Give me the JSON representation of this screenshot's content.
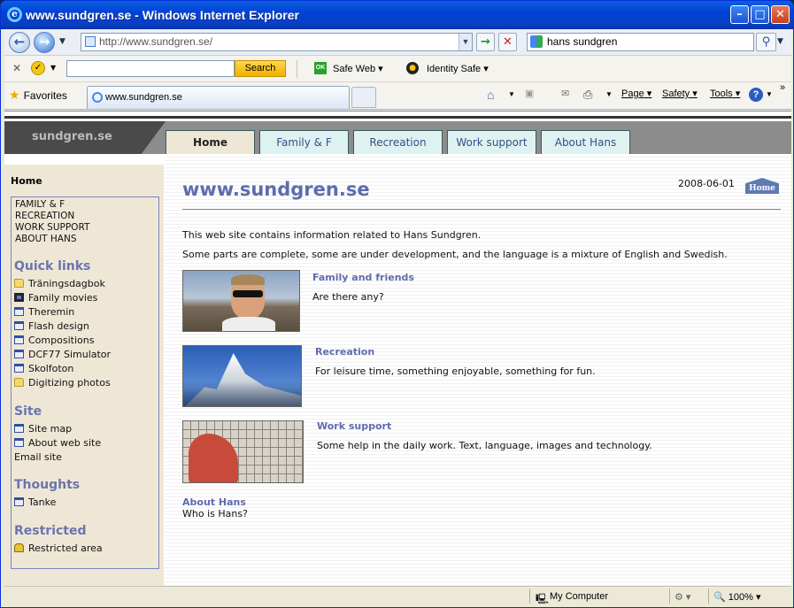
{
  "window": {
    "title": "www.sundgren.se - Windows Internet Explorer"
  },
  "address_bar": {
    "url": "http://www.sundgren.se/",
    "search_value": "hans sundgren"
  },
  "toolbar2": {
    "search_button": "Search",
    "safe_web": "Safe Web",
    "identity_safe": "Identity Safe"
  },
  "tabs_row": {
    "favorites": "Favorites",
    "tab_title": "www.sundgren.se",
    "page_menu": "Page",
    "safety_menu": "Safety",
    "tools_menu": "Tools"
  },
  "site": {
    "logo": "sundgren.se",
    "nav": [
      "Home",
      "Family & F",
      "Recreation",
      "Work support",
      "About Hans"
    ],
    "left_home": "Home",
    "left_links": [
      "Family & F",
      "Recreation",
      "Work support",
      "About Hans"
    ],
    "quick_links_title": "Quick links",
    "quick_links": [
      "Träningsdagbok",
      "Family movies",
      "Theremin",
      "Flash design",
      "Compositions",
      "DCF77 Simulator",
      "Skolfoton",
      "Digitizing photos"
    ],
    "site_title": "Site",
    "site_links": [
      "Site map",
      "About web site",
      "Email site"
    ],
    "thoughts_title": "Thoughts",
    "thoughts_links": [
      "Tanke"
    ],
    "restricted_title": "Restricted",
    "restricted_links": [
      "Restricted area"
    ],
    "page_title": "www.sundgren.se",
    "date": "2008-06-01",
    "home_badge": "Home",
    "intro1": "This web site contains information related to Hans Sundgren.",
    "intro2": "Some parts are complete, some are under development, and the language is a mixture of English and Swedish.",
    "sections": [
      {
        "title": "Family and friends",
        "desc": "Are there any?"
      },
      {
        "title": "Recreation",
        "desc": "For leisure time, something enjoyable, something for fun."
      },
      {
        "title": "Work support",
        "desc": "Some help in the daily work. Text, language, images and technology."
      },
      {
        "title": "About Hans",
        "desc": "Who is Hans?"
      }
    ]
  },
  "statusbar": {
    "zone": "My Computer",
    "zoom": "100%"
  }
}
